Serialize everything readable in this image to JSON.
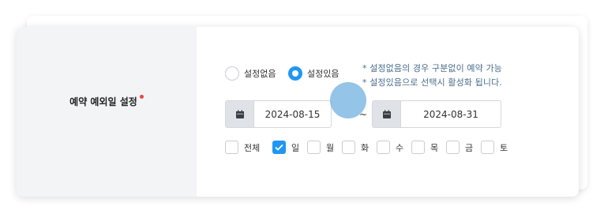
{
  "setting": {
    "label": "예약 예외일 설정",
    "required": true
  },
  "mode": {
    "options": [
      {
        "label": "설정없음",
        "selected": false
      },
      {
        "label": "설정있음",
        "selected": true
      }
    ]
  },
  "hints": [
    "* 설정없음의 경우 구분없이 예약 가능",
    "* 설정있음으로 선택시 활성화 됩니다."
  ],
  "date_range": {
    "start": "2024-08-15",
    "end": "2024-08-31",
    "separator": "~",
    "icon": "calendar-icon"
  },
  "days": [
    {
      "label": "전체",
      "checked": false
    },
    {
      "label": "일",
      "checked": true
    },
    {
      "label": "월",
      "checked": false
    },
    {
      "label": "화",
      "checked": false
    },
    {
      "label": "수",
      "checked": false
    },
    {
      "label": "목",
      "checked": false
    },
    {
      "label": "금",
      "checked": false
    },
    {
      "label": "토",
      "checked": false
    }
  ],
  "colors": {
    "accent": "#2196f3",
    "required": "#ef4444",
    "hint": "#4a6e8a"
  }
}
